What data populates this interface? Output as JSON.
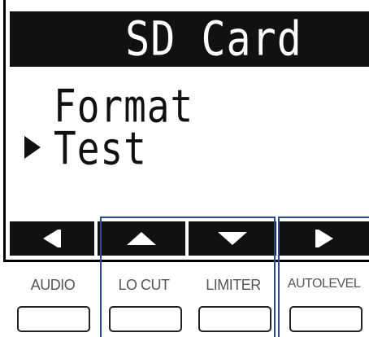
{
  "screen": {
    "title": "SD Card",
    "menu": [
      {
        "label": "Format",
        "selected": false
      },
      {
        "label": "Test",
        "selected": true
      }
    ]
  },
  "softkeys": [
    {
      "icon": "arrow-left-icon"
    },
    {
      "icon": "arrow-up-icon"
    },
    {
      "icon": "arrow-down-icon"
    },
    {
      "icon": "arrow-right-icon"
    }
  ],
  "hardware_buttons": {
    "audio": "AUDIO",
    "lo_cut": "LO CUT",
    "limiter": "LIMITER",
    "autolevel": "AUTOLEVEL"
  },
  "colors": {
    "lcd_dark": "#111111",
    "highlight": "#2c4a8e",
    "label_gray": "#555555"
  }
}
